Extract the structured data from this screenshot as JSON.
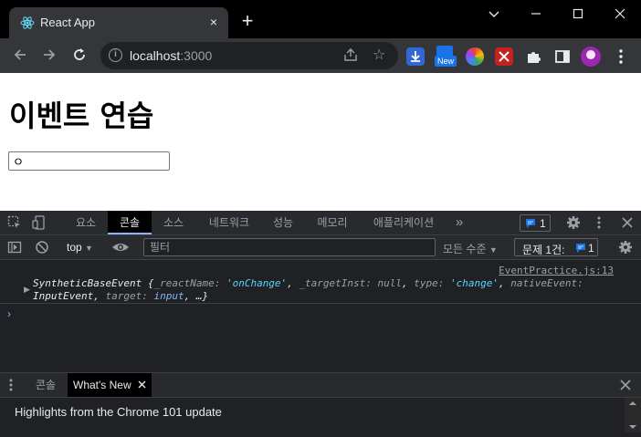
{
  "browser": {
    "tab_title": "React App",
    "tab_close": "×",
    "new_tab": "+",
    "url_host": "localhost",
    "url_port": ":3000",
    "ext_badge": "New"
  },
  "page": {
    "heading": "이벤트 연습",
    "input_value": "ㅇ"
  },
  "devtools": {
    "tabs": [
      "요소",
      "콘솔",
      "소스",
      "네트워크",
      "성능",
      "메모리",
      "애플리케이션"
    ],
    "more_tabs": "»",
    "issues_count": "1",
    "context": "top",
    "filter_placeholder": "필터",
    "levels": "모든 수준",
    "issues_label": "문제 1건:",
    "issues_label_count": "1"
  },
  "console": {
    "source": "EventPractice.js:13",
    "log": {
      "type": "SyntheticBaseEvent",
      "reactName_key": "_reactName",
      "reactName_val": "'onChange'",
      "targetInst_key": "_targetInst",
      "targetInst_val": "null",
      "type_key": "type",
      "type_val": "'change'",
      "nativeEvent_key": "nativeEvent",
      "nativeEvent_val": "InputEvent",
      "target_key": "target",
      "target_val": "input",
      "ellipsis": "…}"
    },
    "prompt": "›"
  },
  "drawer": {
    "tabs": [
      "콘솔",
      "What's New"
    ],
    "highlight": "Highlights from the Chrome 101 update"
  }
}
